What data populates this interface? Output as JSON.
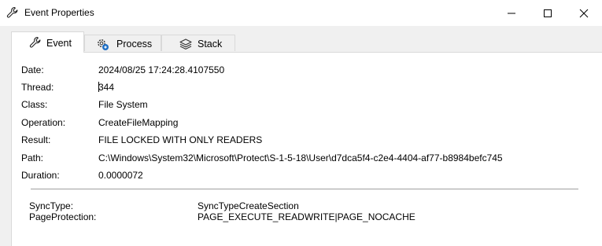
{
  "window": {
    "title": "Event Properties",
    "icon": "wrench-icon",
    "controls": [
      "minimize-icon",
      "maximize-icon",
      "close-icon"
    ]
  },
  "tabs": [
    {
      "label": "Event",
      "icon": "wrench-icon",
      "active": true
    },
    {
      "label": "Process",
      "icon": "gear-icon",
      "active": false
    },
    {
      "label": "Stack",
      "icon": "layers-icon",
      "active": false
    }
  ],
  "event": {
    "date_label": "Date:",
    "date_value": "2024/08/25 17:24:28.4107550",
    "thread_label": "Thread:",
    "thread_value": "344",
    "class_label": "Class:",
    "class_value": "File System",
    "operation_label": "Operation:",
    "operation_value": "CreateFileMapping",
    "result_label": "Result:",
    "result_value": "FILE LOCKED WITH ONLY READERS",
    "path_label": "Path:",
    "path_value": "C:\\Windows\\System32\\Microsoft\\Protect\\S-1-5-18\\User\\d7dca5f4-c2e4-4404-af77-b8984befc745",
    "duration_label": "Duration:",
    "duration_value": "0.0000072"
  },
  "details": [
    {
      "key": "SyncType:",
      "value": "SyncTypeCreateSection"
    },
    {
      "key": "PageProtection:",
      "value": "PAGE_EXECUTE_READWRITE|PAGE_NOCACHE"
    }
  ]
}
